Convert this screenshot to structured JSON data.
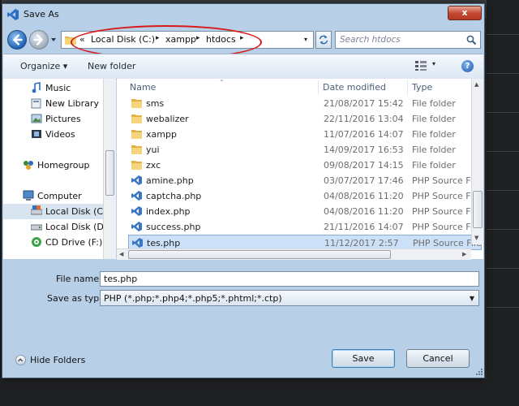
{
  "window": {
    "title": "Save As",
    "close_glyph": "x"
  },
  "address": {
    "prefix": "«",
    "crumbs": [
      "Local Disk (C:)",
      "xampp",
      "htdocs"
    ],
    "separator": "▸",
    "dropdown_glyph": "▾"
  },
  "search": {
    "placeholder": "Search htdocs"
  },
  "toolbar": {
    "organize": "Organize ▾",
    "new_folder": "New folder",
    "help": "?",
    "views_drop": "▾"
  },
  "nav": {
    "items": [
      {
        "label": "Music",
        "icon": "music-icon"
      },
      {
        "label": "New Library",
        "icon": "library-icon"
      },
      {
        "label": "Pictures",
        "icon": "pictures-icon"
      },
      {
        "label": "Videos",
        "icon": "videos-icon"
      },
      {
        "label": "Homegroup",
        "icon": "homegroup-icon"
      },
      {
        "label": "Computer",
        "icon": "computer-icon"
      },
      {
        "label": "Local Disk (C:)",
        "icon": "drive-icon"
      },
      {
        "label": "Local Disk (D:)",
        "icon": "drive-icon"
      },
      {
        "label": "CD Drive (F:) M",
        "icon": "cd-drive-icon"
      }
    ],
    "selected_index": 6
  },
  "files": {
    "columns": [
      "Name",
      "Date modified",
      "Type"
    ],
    "rows": [
      {
        "name": "sms",
        "date": "21/08/2017 15:42",
        "type": "File folder",
        "icon": "folder-icon"
      },
      {
        "name": "webalizer",
        "date": "22/11/2016 13:04",
        "type": "File folder",
        "icon": "folder-icon"
      },
      {
        "name": "xampp",
        "date": "11/07/2016 14:07",
        "type": "File folder",
        "icon": "folder-icon"
      },
      {
        "name": "yui",
        "date": "14/09/2017 16:53",
        "type": "File folder",
        "icon": "folder-icon"
      },
      {
        "name": "zxc",
        "date": "09/08/2017 14:15",
        "type": "File folder",
        "icon": "folder-icon"
      },
      {
        "name": "amine.php",
        "date": "03/07/2017 17:46",
        "type": "PHP Source File",
        "icon": "php-file-icon"
      },
      {
        "name": "captcha.php",
        "date": "04/08/2016 11:20",
        "type": "PHP Source File",
        "icon": "php-file-icon"
      },
      {
        "name": "index.php",
        "date": "04/08/2016 11:20",
        "type": "PHP Source File",
        "icon": "php-file-icon"
      },
      {
        "name": "success.php",
        "date": "21/11/2016 14:07",
        "type": "PHP Source File",
        "icon": "php-file-icon"
      },
      {
        "name": "tes.php",
        "date": "11/12/2017 2:57",
        "type": "PHP Source File",
        "icon": "php-file-icon"
      }
    ],
    "selected_index": 9
  },
  "form": {
    "filename_label": "File name:",
    "filename_value": "tes.php",
    "type_label": "Save as type:",
    "type_value": "PHP (*.php;*.php4;*.php5;*.phtml;*.ctp)"
  },
  "footer": {
    "hide_folders": "Hide Folders",
    "save": "Save",
    "cancel": "Cancel"
  },
  "colors": {
    "dialog_frame": "#b7cfe7",
    "selection": "#cce0f7",
    "annotation_ellipse": "#d81a1a"
  }
}
